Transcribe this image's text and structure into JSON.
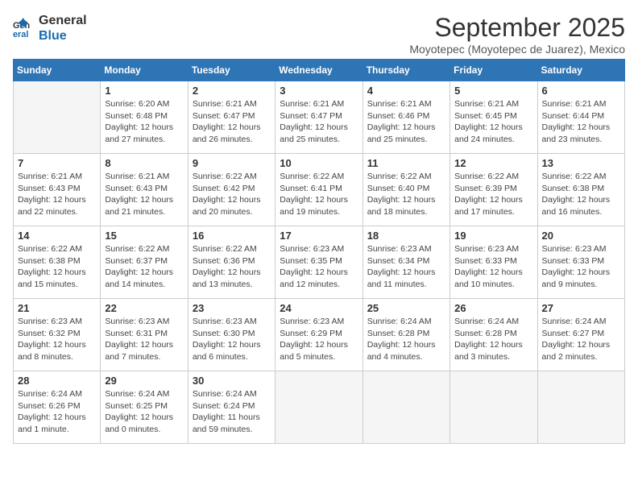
{
  "logo": {
    "line1": "General",
    "line2": "Blue"
  },
  "title": "September 2025",
  "subtitle": "Moyotepec (Moyotepec de Juarez), Mexico",
  "weekdays": [
    "Sunday",
    "Monday",
    "Tuesday",
    "Wednesday",
    "Thursday",
    "Friday",
    "Saturday"
  ],
  "weeks": [
    [
      {
        "day": "",
        "info": ""
      },
      {
        "day": "1",
        "info": "Sunrise: 6:20 AM\nSunset: 6:48 PM\nDaylight: 12 hours\nand 27 minutes."
      },
      {
        "day": "2",
        "info": "Sunrise: 6:21 AM\nSunset: 6:47 PM\nDaylight: 12 hours\nand 26 minutes."
      },
      {
        "day": "3",
        "info": "Sunrise: 6:21 AM\nSunset: 6:47 PM\nDaylight: 12 hours\nand 25 minutes."
      },
      {
        "day": "4",
        "info": "Sunrise: 6:21 AM\nSunset: 6:46 PM\nDaylight: 12 hours\nand 25 minutes."
      },
      {
        "day": "5",
        "info": "Sunrise: 6:21 AM\nSunset: 6:45 PM\nDaylight: 12 hours\nand 24 minutes."
      },
      {
        "day": "6",
        "info": "Sunrise: 6:21 AM\nSunset: 6:44 PM\nDaylight: 12 hours\nand 23 minutes."
      }
    ],
    [
      {
        "day": "7",
        "info": "Sunrise: 6:21 AM\nSunset: 6:43 PM\nDaylight: 12 hours\nand 22 minutes."
      },
      {
        "day": "8",
        "info": "Sunrise: 6:21 AM\nSunset: 6:43 PM\nDaylight: 12 hours\nand 21 minutes."
      },
      {
        "day": "9",
        "info": "Sunrise: 6:22 AM\nSunset: 6:42 PM\nDaylight: 12 hours\nand 20 minutes."
      },
      {
        "day": "10",
        "info": "Sunrise: 6:22 AM\nSunset: 6:41 PM\nDaylight: 12 hours\nand 19 minutes."
      },
      {
        "day": "11",
        "info": "Sunrise: 6:22 AM\nSunset: 6:40 PM\nDaylight: 12 hours\nand 18 minutes."
      },
      {
        "day": "12",
        "info": "Sunrise: 6:22 AM\nSunset: 6:39 PM\nDaylight: 12 hours\nand 17 minutes."
      },
      {
        "day": "13",
        "info": "Sunrise: 6:22 AM\nSunset: 6:38 PM\nDaylight: 12 hours\nand 16 minutes."
      }
    ],
    [
      {
        "day": "14",
        "info": "Sunrise: 6:22 AM\nSunset: 6:38 PM\nDaylight: 12 hours\nand 15 minutes."
      },
      {
        "day": "15",
        "info": "Sunrise: 6:22 AM\nSunset: 6:37 PM\nDaylight: 12 hours\nand 14 minutes."
      },
      {
        "day": "16",
        "info": "Sunrise: 6:22 AM\nSunset: 6:36 PM\nDaylight: 12 hours\nand 13 minutes."
      },
      {
        "day": "17",
        "info": "Sunrise: 6:23 AM\nSunset: 6:35 PM\nDaylight: 12 hours\nand 12 minutes."
      },
      {
        "day": "18",
        "info": "Sunrise: 6:23 AM\nSunset: 6:34 PM\nDaylight: 12 hours\nand 11 minutes."
      },
      {
        "day": "19",
        "info": "Sunrise: 6:23 AM\nSunset: 6:33 PM\nDaylight: 12 hours\nand 10 minutes."
      },
      {
        "day": "20",
        "info": "Sunrise: 6:23 AM\nSunset: 6:33 PM\nDaylight: 12 hours\nand 9 minutes."
      }
    ],
    [
      {
        "day": "21",
        "info": "Sunrise: 6:23 AM\nSunset: 6:32 PM\nDaylight: 12 hours\nand 8 minutes."
      },
      {
        "day": "22",
        "info": "Sunrise: 6:23 AM\nSunset: 6:31 PM\nDaylight: 12 hours\nand 7 minutes."
      },
      {
        "day": "23",
        "info": "Sunrise: 6:23 AM\nSunset: 6:30 PM\nDaylight: 12 hours\nand 6 minutes."
      },
      {
        "day": "24",
        "info": "Sunrise: 6:23 AM\nSunset: 6:29 PM\nDaylight: 12 hours\nand 5 minutes."
      },
      {
        "day": "25",
        "info": "Sunrise: 6:24 AM\nSunset: 6:28 PM\nDaylight: 12 hours\nand 4 minutes."
      },
      {
        "day": "26",
        "info": "Sunrise: 6:24 AM\nSunset: 6:28 PM\nDaylight: 12 hours\nand 3 minutes."
      },
      {
        "day": "27",
        "info": "Sunrise: 6:24 AM\nSunset: 6:27 PM\nDaylight: 12 hours\nand 2 minutes."
      }
    ],
    [
      {
        "day": "28",
        "info": "Sunrise: 6:24 AM\nSunset: 6:26 PM\nDaylight: 12 hours\nand 1 minute."
      },
      {
        "day": "29",
        "info": "Sunrise: 6:24 AM\nSunset: 6:25 PM\nDaylight: 12 hours\nand 0 minutes."
      },
      {
        "day": "30",
        "info": "Sunrise: 6:24 AM\nSunset: 6:24 PM\nDaylight: 11 hours\nand 59 minutes."
      },
      {
        "day": "",
        "info": ""
      },
      {
        "day": "",
        "info": ""
      },
      {
        "day": "",
        "info": ""
      },
      {
        "day": "",
        "info": ""
      }
    ]
  ]
}
